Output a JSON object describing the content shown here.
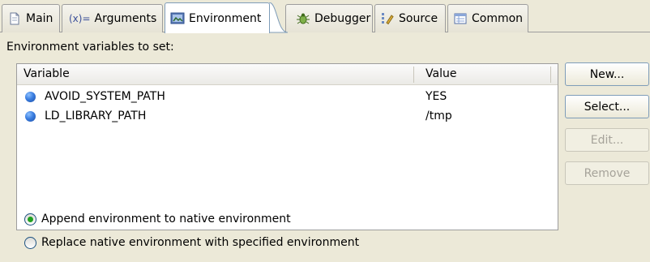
{
  "tabs": [
    {
      "label": "Main",
      "icon": "document-icon"
    },
    {
      "label": "Arguments",
      "prefix": "(x)=",
      "icon": "arguments-icon"
    },
    {
      "label": "Environment",
      "icon": "environment-icon",
      "active": true
    },
    {
      "label": "Debugger",
      "icon": "bug-icon"
    },
    {
      "label": "Source",
      "icon": "source-icon"
    },
    {
      "label": "Common",
      "icon": "common-icon"
    }
  ],
  "section_label": "Environment variables to set:",
  "table": {
    "columns": [
      "Variable",
      "Value"
    ],
    "rows": [
      {
        "variable": "AVOID_SYSTEM_PATH",
        "value": "YES"
      },
      {
        "variable": "LD_LIBRARY_PATH",
        "value": "/tmp"
      }
    ]
  },
  "buttons": {
    "new": "New...",
    "select": "Select...",
    "edit": "Edit...",
    "remove": "Remove"
  },
  "radios": [
    {
      "label": "Append environment to native environment",
      "checked": true
    },
    {
      "label": "Replace native environment with specified environment",
      "checked": false
    }
  ],
  "colors": {
    "background": "#ece9d8",
    "border": "#9d9d9d",
    "bullet": "#3b7ee0",
    "radio_dot": "#21a121"
  }
}
